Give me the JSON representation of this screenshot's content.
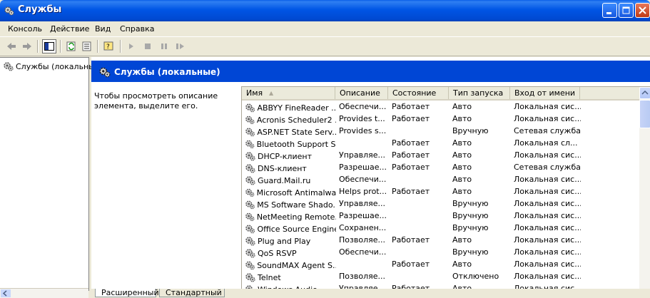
{
  "window": {
    "title": "Службы",
    "icon": "services-gear-icon"
  },
  "menubar": {
    "items": [
      "Консоль",
      "Действие",
      "Вид",
      "Справка"
    ]
  },
  "toolbar": {
    "buttons": [
      "back-arrow-icon",
      "forward-arrow-icon",
      "show-hide-tree-icon",
      "refresh-icon",
      "export-list-icon",
      "help-icon",
      "play-icon",
      "stop-icon",
      "pause-icon",
      "restart-icon"
    ]
  },
  "tree": {
    "root_label": "Службы (локальны"
  },
  "banner": {
    "title": "Службы (локальные)"
  },
  "description": {
    "text": "Чтобы просмотреть описание элемента, выделите его."
  },
  "list": {
    "columns": [
      "Имя",
      "Описание",
      "Состояние",
      "Тип запуска",
      "Вход от имени"
    ],
    "sort_indicator": "▲",
    "rows": [
      [
        "ABBYY FineReader ...",
        "Обеспечи...",
        "Работает",
        "Авто",
        "Локальная сис..."
      ],
      [
        "Acronis Scheduler2 ...",
        "Provides t...",
        "Работает",
        "Авто",
        "Локальная сис..."
      ],
      [
        "ASP.NET State Serv...",
        "Provides s...",
        "",
        "Вручную",
        "Сетевая служба"
      ],
      [
        "Bluetooth Support S...",
        "",
        "Работает",
        "Авто",
        "Локальная сл..."
      ],
      [
        "DHCP-клиент",
        "Управляе...",
        "Работает",
        "Авто",
        "Локальная сис..."
      ],
      [
        "DNS-клиент",
        "Разрешае...",
        "Работает",
        "Авто",
        "Сетевая служба"
      ],
      [
        "Guard.Mail.ru",
        "Обеспечи...",
        "",
        "Авто",
        "Локальная сис..."
      ],
      [
        "Microsoft Antimalwa...",
        "Helps prot...",
        "Работает",
        "Авто",
        "Локальная сис..."
      ],
      [
        "MS Software Shado...",
        "Управляе...",
        "",
        "Вручную",
        "Локальная сис..."
      ],
      [
        "NetMeeting Remote...",
        "Разрешае...",
        "",
        "Вручную",
        "Локальная сис..."
      ],
      [
        "Office Source Engine",
        "Сохранен...",
        "",
        "Вручную",
        "Локальная сис..."
      ],
      [
        "Plug and Play",
        "Позволяе...",
        "Работает",
        "Авто",
        "Локальная сис..."
      ],
      [
        "QoS RSVP",
        "Обеспечи...",
        "",
        "Вручную",
        "Локальная сис..."
      ],
      [
        "SoundMAX Agent S...",
        "",
        "Работает",
        "Авто",
        "Локальная сис..."
      ],
      [
        "Telnet",
        "Позволяе...",
        "",
        "Отключено",
        "Локальная сис..."
      ],
      [
        "Windows Audio",
        "Управляе...",
        "Работает",
        "Авто",
        "Локальная сис..."
      ]
    ]
  },
  "tabs": [
    "Расширенный",
    "Стандартный"
  ],
  "colors": {
    "title_blue": "#0055e5",
    "banner_blue": "#0046d5",
    "face": "#ece9d8"
  }
}
